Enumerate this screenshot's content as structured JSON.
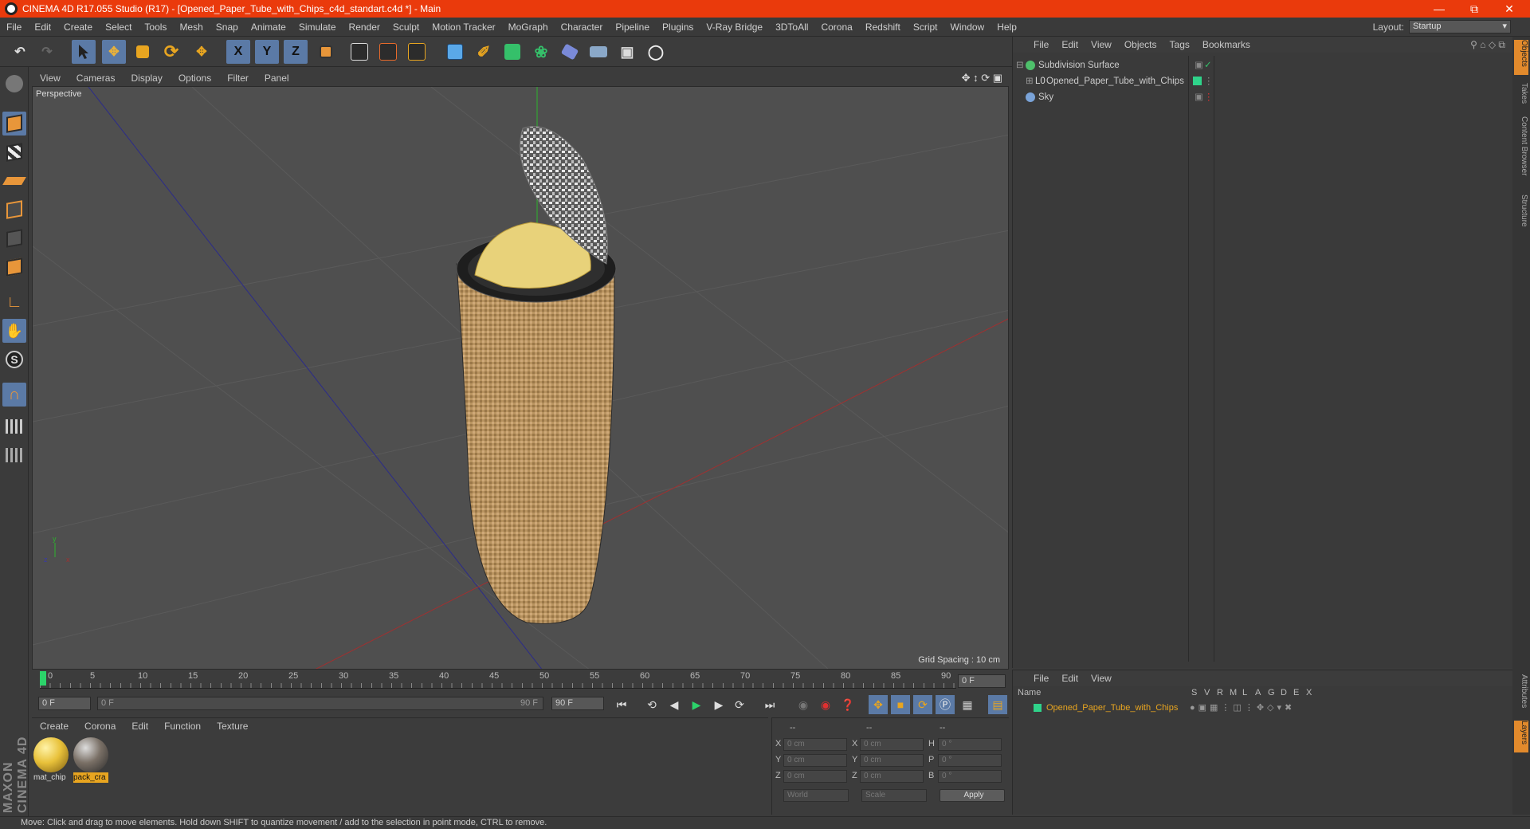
{
  "window": {
    "title": "CINEMA 4D R17.055 Studio (R17) - [Opened_Paper_Tube_with_Chips_c4d_standart.c4d *] - Main",
    "min_icon": "minimize-icon",
    "max_icon": "restore-icon",
    "close_icon": "close-icon",
    "accent": "#ea3a0c"
  },
  "menu": [
    "File",
    "Edit",
    "Create",
    "Select",
    "Tools",
    "Mesh",
    "Snap",
    "Animate",
    "Simulate",
    "Render",
    "Sculpt",
    "Motion Tracker",
    "MoGraph",
    "Character",
    "Pipeline",
    "Plugins",
    "V-Ray Bridge",
    "3DToAll",
    "Corona",
    "Redshift",
    "Script",
    "Window",
    "Help"
  ],
  "layout": {
    "label": "Layout:",
    "value": "Startup"
  },
  "toolbar": {
    "x": "X",
    "y": "Y",
    "z": "Z"
  },
  "viewport": {
    "menu": [
      "View",
      "Cameras",
      "Display",
      "Options",
      "Filter",
      "Panel"
    ],
    "label": "Perspective",
    "grid_spacing": "Grid Spacing : 10 cm"
  },
  "timeline": {
    "ticks": [
      "0",
      "5",
      "10",
      "15",
      "20",
      "25",
      "30",
      "35",
      "40",
      "45",
      "50",
      "55",
      "60",
      "65",
      "70",
      "75",
      "80",
      "85",
      "90"
    ],
    "current_frame": "0 F",
    "start": "0 F",
    "range_start": "0 F",
    "range_end": "90 F",
    "end": "90 F"
  },
  "materials": {
    "menu": [
      "Create",
      "Corona",
      "Edit",
      "Function",
      "Texture"
    ],
    "items": [
      {
        "name": "mat_chip",
        "color": "#e8c13a"
      },
      {
        "name": "pack_cra",
        "color": "#7a7066"
      }
    ]
  },
  "coords": {
    "header": [
      "--",
      "--",
      "--"
    ],
    "rows": [
      {
        "a": "X",
        "av": "0 cm",
        "b": "X",
        "bv": "0 cm",
        "c": "H",
        "cv": "0 °"
      },
      {
        "a": "Y",
        "av": "0 cm",
        "b": "Y",
        "bv": "0 cm",
        "c": "P",
        "cv": "0 °"
      },
      {
        "a": "Z",
        "av": "0 cm",
        "b": "Z",
        "bv": "0 cm",
        "c": "B",
        "cv": "0 °"
      }
    ],
    "world": "World",
    "scale": "Scale",
    "apply": "Apply"
  },
  "objects": {
    "menu": [
      "File",
      "Edit",
      "View",
      "Objects",
      "Tags",
      "Bookmarks"
    ],
    "items": [
      {
        "name": "Subdivision Surface",
        "color": "#4ec06b"
      },
      {
        "name": "Opened_Paper_Tube_with_Chips",
        "color": "#2fd38a"
      },
      {
        "name": "Sky",
        "color": "#7aa3d8"
      }
    ]
  },
  "layers": {
    "menu": [
      "File",
      "Edit",
      "View"
    ],
    "header_name": "Name",
    "cols": [
      "S",
      "V",
      "R",
      "M",
      "L",
      "A",
      "G",
      "D",
      "E",
      "X"
    ],
    "items": [
      {
        "name": "Opened_Paper_Tube_with_Chips",
        "color": "#2fd38a"
      }
    ]
  },
  "right_tabs": [
    "Objects",
    "Takes",
    "Content Browser",
    "Structure",
    "Attributes",
    "Layers"
  ],
  "status": "Move: Click and drag to move elements. Hold down SHIFT to quantize movement / add to the selection in point mode, CTRL to remove.",
  "brand": "MAXON CINEMA 4D"
}
